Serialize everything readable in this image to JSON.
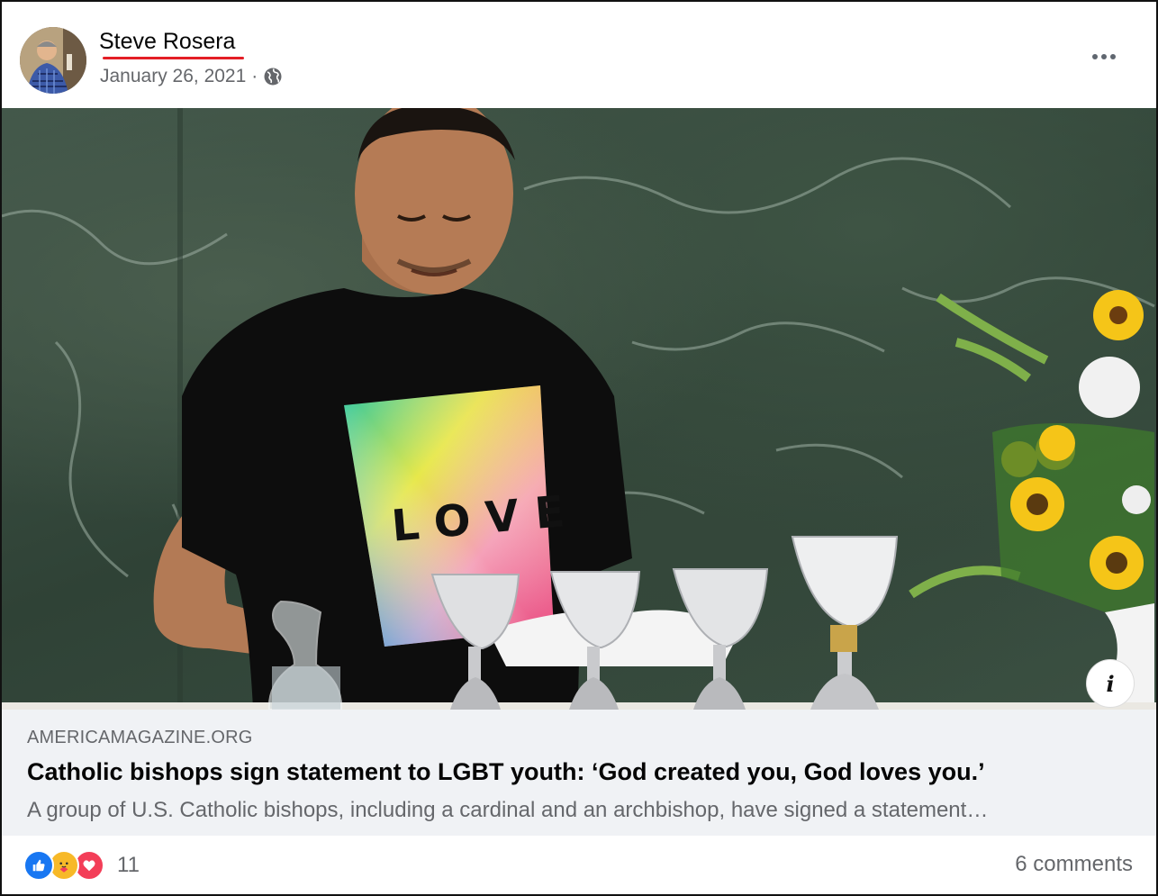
{
  "post": {
    "author": "Steve Rosera",
    "date": "January 26, 2021",
    "separator": "·",
    "audience_icon": "globe-icon",
    "more_icon": "more-horizontal-icon"
  },
  "image": {
    "shirt_text": "LOVE",
    "info_label": "i"
  },
  "link_preview": {
    "domain": "AMERICAMAGAZINE.ORG",
    "title": "Catholic bishops sign statement to LGBT youth: ‘God created you, God loves you.’",
    "description": "A group of U.S. Catholic bishops, including a cardinal and an archbishop, have signed a statement…"
  },
  "footer": {
    "reaction_icons": [
      "like-icon",
      "care-icon",
      "love-icon"
    ],
    "reaction_count": "11",
    "comments": "6 comments"
  },
  "colors": {
    "like": "#1877f2",
    "care": "#f7b928",
    "love": "#f33e58",
    "author_underline": "#e41e26",
    "secondary_text": "#65676b",
    "preview_bg": "#f0f2f5"
  }
}
